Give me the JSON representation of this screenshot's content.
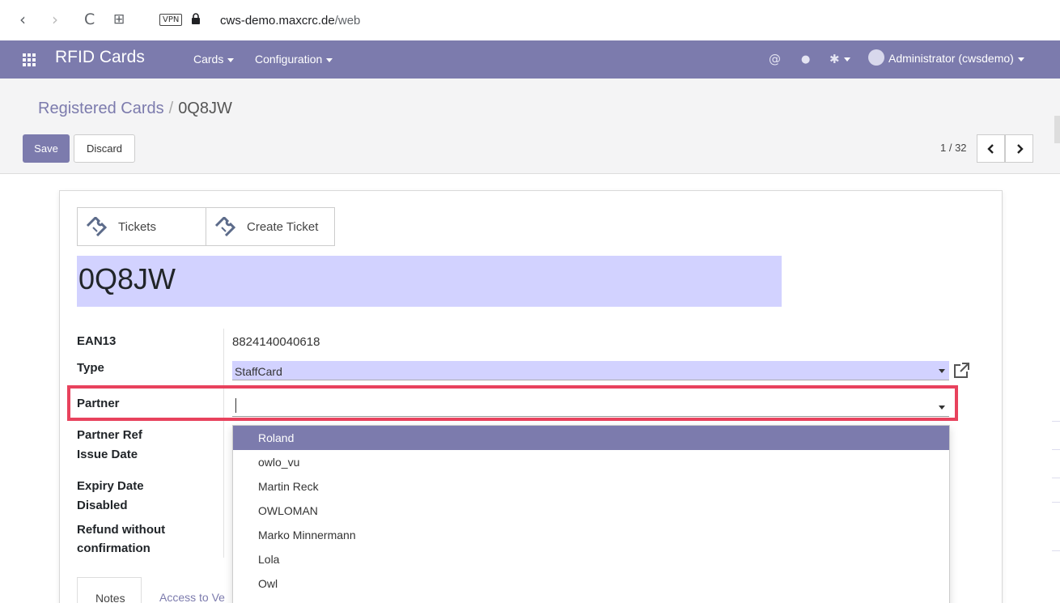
{
  "browser": {
    "back_glyph": "‹",
    "forward_glyph": "›",
    "reload_glyph": "C",
    "tabs_glyph": "⊞",
    "vpn_label": "VPN",
    "url_host": "cws-demo.maxcrc.de",
    "url_path": "/web"
  },
  "topnav": {
    "app_title": "RFID Cards",
    "menus": [
      "Cards",
      "Configuration"
    ],
    "at_glyph": "@",
    "chat_glyph": "●",
    "debug_glyph": "✱",
    "user": "Administrator (cwsdemo)",
    "bg_color": "#7c7bad"
  },
  "control_panel": {
    "breadcrumb_parent": "Registered Cards",
    "breadcrumb_sep": "/",
    "breadcrumb_current": "0Q8JW",
    "save_label": "Save",
    "discard_label": "Discard",
    "pager": "1 / 32"
  },
  "form": {
    "smart_buttons": [
      "Tickets",
      "Create Ticket"
    ],
    "name": "0Q8JW",
    "labels": {
      "ean13": "EAN13",
      "type": "Type",
      "partner": "Partner",
      "partner_ref": "Partner Ref",
      "issue_date": "Issue Date",
      "expiry_date": "Expiry Date",
      "disabled": "Disabled",
      "refund_line1": "Refund without",
      "refund_line2": "confirmation"
    },
    "ean13_value": "8824140040618",
    "type_value": "StaffCard",
    "partner_value": "",
    "partner_options": [
      "Roland",
      "owlo_vu",
      "Martin Reck",
      "OWLOMAN",
      "Marko Minnermann",
      "Lola",
      "Owl"
    ],
    "tabs": [
      "Notes",
      "Access to Ve"
    ]
  },
  "colors": {
    "accent": "#7c7bad",
    "highlight_border": "#e8425d",
    "required_field_bg": "#d2d2ff"
  }
}
